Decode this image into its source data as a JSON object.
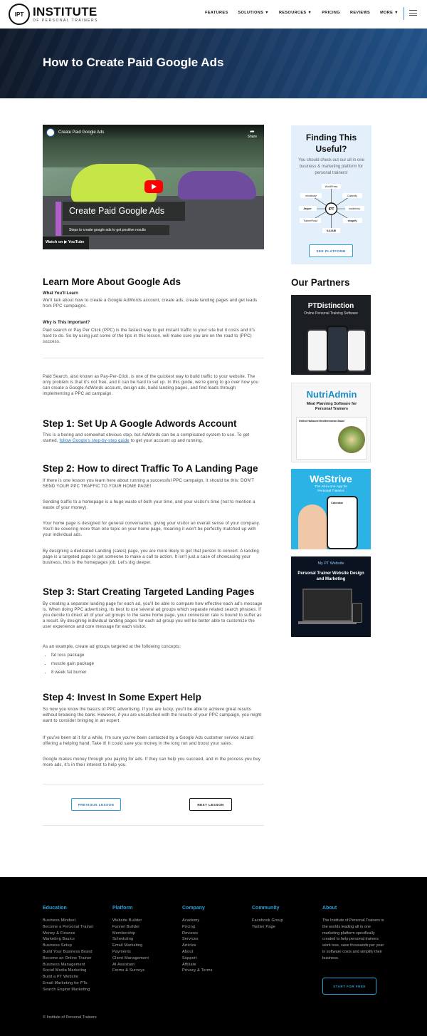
{
  "header": {
    "logo_badge": "IPT",
    "logo_main": "INSTITUTE",
    "logo_sub": "OF PERSONAL TRAINERS",
    "nav": [
      "FEATURES",
      "SOLUTIONS ▼",
      "RESOURCES ▼",
      "PRICING",
      "REVIEWS",
      "MORE ▼"
    ]
  },
  "hero": {
    "title": "How to Create Paid Google Ads"
  },
  "video": {
    "title": "Create Paid Google Ads",
    "share": "Share",
    "overlay_title": "Create Paid Google Ads",
    "overlay_sub": "Steps to create google ads to get positive results",
    "watch": "Watch on ▶ YouTube"
  },
  "article": {
    "h_learn": "Learn More About Google Ads",
    "what_head": "What You'll Learn",
    "what_text": "We'll talk about how to create a Google AdWords account, create ads, create landing pages and get leads from PPC campaigns.",
    "why_head": "Why is This Important?",
    "why_text": "Paid search or Pay Per Click (PPC) is the fastest way to get instant traffic to your site but it costs and it's hard to do. So by using just some of the tips in this lesson, will make sure you are on the road to (PPC) success.",
    "intro": "Paid Search, also known as Pay-Per-Click, is one of the quickest way to build traffic to your website. The only problem is that it's not free, and it can be hard to set up. In this guide, we're going to go over how you can create a Google AdWords account, design ads, build landing pages, and find leads through implementing a PPC ad campaign.",
    "step1_h": "Step 1: Set Up A Google Adwords Account",
    "step1_a": "This is a boring and somewhat obvious step, but AdWords can be a complicated system to use. To get started,",
    "step1_link": "follow Google's step-by-step guide",
    "step1_b": "to get your account up and running.",
    "step2_h": "Step 2: How to direct Traffic To A Landing Page",
    "step2_p1": "If there is one lesson you learn here about running a successful PPC campaign, it should be this: DON'T SEND YOUR PPC TRAFFIC TO YOUR HOME PAGE!",
    "step2_p2": "Sending traffic to a homepage is a huge waste of both your time, and your visitor's time (not to mention a waste of your money).",
    "step2_p3": "Your home page is designed for general conversation, giving your visitor an overall sense of your company. You'll be covering more than one topic on your home page, meaning it won't be perfectly matched up with your individual ads.",
    "step2_p4": "By designing a dedicated Landing  (sales) page, you are more likely to get that person to convert. A landing page is a targeted page to get someone to make a call to action. It isn't just a case of showcasing your business, this is the homepages job. Let's dig deeper.",
    "step3_h": "Step 3: Start Creating Targeted Landing Pages",
    "step3_p1": "By creating a separate landing page for each ad, you'll be able to compare how effective each ad's message is. When doing PPC advertising, its best to use several ad groups which separate related search phrases. If you decide to direct all of your ad groups to the same home page, your conversion rate is bound to suffer as a result. By designing individual landing pages for each ad group you will be better able to customize the user experience and core message for each visitor.",
    "step3_p2": "As an example, create ad groups targeted at the following concepts:",
    "step3_list": [
      "fat loss package",
      "muscle gain package",
      "8 week fat burner"
    ],
    "step4_h": "Step 4: Invest In Some Expert Help",
    "step4_p1": "So now you know the basics of PPC advertising. If you are lucky, you'll be able to achieve great results without breaking the bank. However, if you are unsatisfied with the results of your PPC campaign, you might want to consider bringing in an expert.",
    "step4_p2": "If you've been at it for a while, I'm sure you've been contacted by a Google Ads customer service wizard offering a helping hand. Take it! It could save you money in the long run and boost your sales.",
    "step4_p3": "Google makes money through you paying for ads. If they can help you succeed, and in the process you buy more ads, it's in their interest to help you.",
    "prev": "PREVIOUS LESSON",
    "next": "NEXT LESSON"
  },
  "sidebar": {
    "title": "Finding This Useful?",
    "text": "You should check out our all in one business & marketing platform for personal trainers!",
    "diagram_center": "IPT",
    "diagram_labels": [
      "WordPress",
      "mindbody",
      "Calendly",
      "Jasper",
      "mailchimp",
      "TrainerRoad",
      "shopify",
      "KAJABI"
    ],
    "button": "SEE PLATFORM",
    "partners": "Our Partners",
    "ad1_title": "PTDistinction",
    "ad1_sub": "Online Personal Training Software",
    "ad2_title": "NutriAdmin",
    "ad2_sub": "Meal Planning Software for Personal Trainers",
    "ad2_card": "Grilled Halloumi Mediterranean Salad",
    "ad3_title": "WeStrive",
    "ad3_sub": "The All-in-one App for Personal Trainers",
    "ad3_widget": "Calendar",
    "ad4_logo": "My PT Website",
    "ad4_sub": "Personal Trainer Website Design and Marketing"
  },
  "footer": {
    "columns": [
      {
        "title": "Education",
        "items": [
          "Business Mindset",
          "Become a Personal Trainer",
          "Money & Finance",
          "Marketing Basics",
          "Business Setup",
          "Build Your Business Brand",
          "Become an Online Trainer",
          "Business Management",
          "Social Media Marketing",
          "Build a PT Website",
          "Email Marketing for PTs",
          "Search Engine Marketing"
        ]
      },
      {
        "title": "Platform",
        "items": [
          "Website Builder",
          "Funnel Builder",
          "Membership",
          "Scheduling",
          "Email Marketing",
          "Payments",
          "Client Management",
          "AI Assistant",
          "Forms & Surveys"
        ]
      },
      {
        "title": "Company",
        "items": [
          "Academy",
          "Pricing",
          "Reviews",
          "Services",
          "Articles",
          "About",
          "Support",
          "Affiliate",
          "Privacy & Terms"
        ]
      },
      {
        "title": "Community",
        "items": [
          "Facebook Group",
          "Twitter Page"
        ]
      }
    ],
    "about_title": "About",
    "about_text": "The Institute of Personal Trainers is the worlds leading all in one marketing platform specifically created to help personal trainers work less, save thousands per year in software costs and simplify their business.",
    "about_button": "START FOR FREE",
    "copyright": "© Institute of Personal Trainers"
  }
}
